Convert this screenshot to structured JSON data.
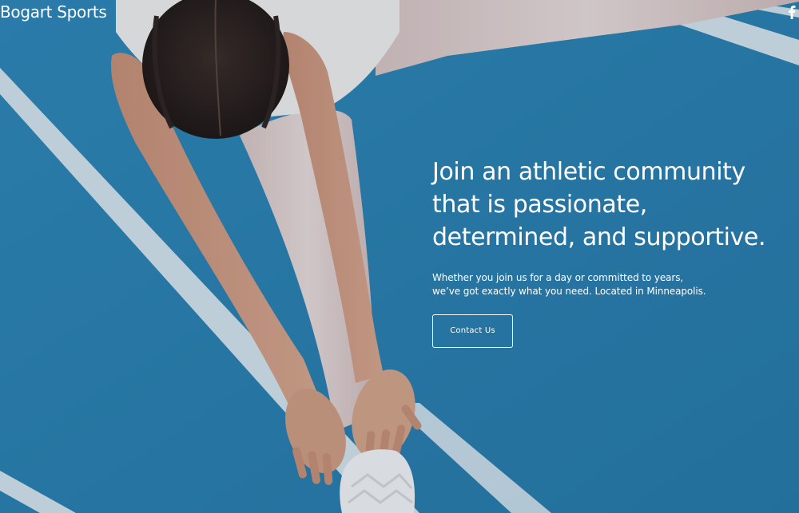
{
  "site": {
    "brand": "Bogart Sports",
    "social": [
      "facebook-icon"
    ]
  },
  "hero": {
    "headline": "Join an athletic community that is passionate, determined, and supportive.",
    "subtext_line1": "Whether you join us for a day or committed to years,",
    "subtext_line2": "we’ve got exactly what you need. Located in Minneapolis.",
    "cta_label": "Contact Us"
  },
  "colors": {
    "track_blue": "#2a7fae",
    "lane_line": "#e8eef2",
    "text": "#ffffff"
  }
}
